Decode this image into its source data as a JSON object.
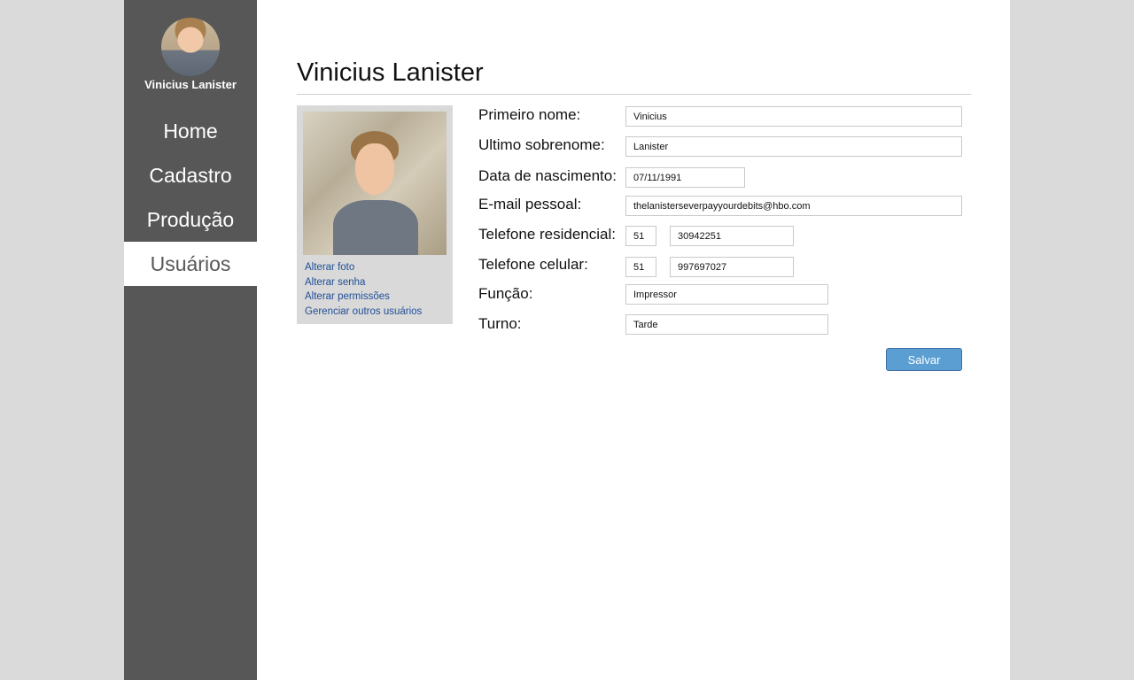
{
  "sidebar": {
    "user_name": "Vinicius Lanister",
    "nav": [
      {
        "label": "Home",
        "active": false
      },
      {
        "label": "Cadastro",
        "active": false
      },
      {
        "label": "Produção",
        "active": false
      },
      {
        "label": "Usuários",
        "active": true
      }
    ]
  },
  "main": {
    "title": "Vinicius Lanister",
    "photo_links": {
      "change_photo": "Alterar foto",
      "change_password": "Alterar senha",
      "change_permissions": "Alterar permissões",
      "manage_users": "Gerenciar outros usuários"
    },
    "form": {
      "first_name": {
        "label": "Primeiro nome:",
        "value": "Vinicius"
      },
      "last_name": {
        "label": "Ultimo sobrenome:",
        "value": "Lanister"
      },
      "birth_date": {
        "label": "Data de nascimento:",
        "value": "07/11/1991"
      },
      "email": {
        "label": "E-mail pessoal:",
        "value": "thelanisterseverpayyourdebits@hbo.com"
      },
      "home_phone": {
        "label": "Telefone residencial:",
        "area": "51",
        "number": "30942251"
      },
      "cell_phone": {
        "label": "Telefone celular:",
        "area": "51",
        "number": "997697027"
      },
      "role": {
        "label": "Função:",
        "value": "Impressor"
      },
      "shift": {
        "label": "Turno:",
        "value": "Tarde"
      }
    },
    "save_label": "Salvar"
  },
  "colors": {
    "page_background": "#dadada",
    "sidebar": "#575757",
    "link": "#1f4e96",
    "button": "#5b9fd2"
  }
}
